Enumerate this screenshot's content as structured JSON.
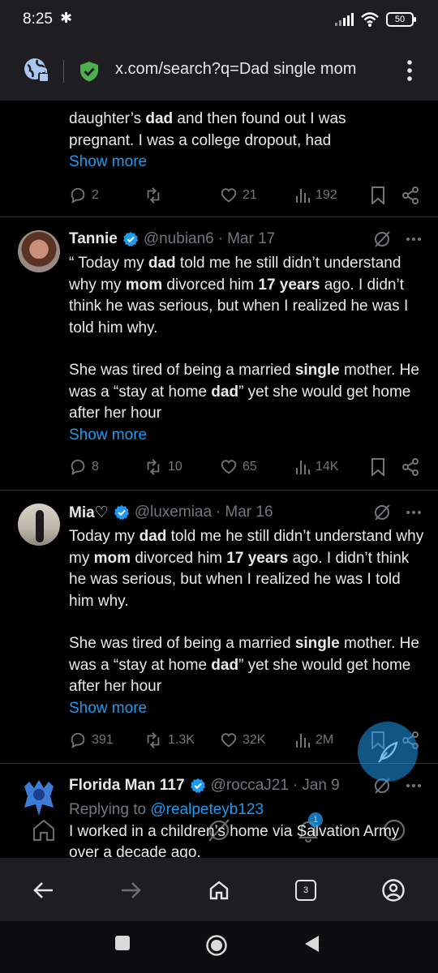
{
  "status_bar": {
    "time": "8:25",
    "battery": "50"
  },
  "browser": {
    "url": "x.com/search?q=Dad single mom",
    "tab_count": "3"
  },
  "tweets": [
    {
      "text_lines": [
        "daughter’s ",
        "dad",
        " and then found out I was",
        "pregnant. I was a college dropout, had"
      ],
      "show_more": "Show more",
      "replies": "2",
      "retweets": "",
      "likes": "21",
      "views": "192"
    },
    {
      "name": "Tannie",
      "handle": "@nubian6",
      "date": "Mar 17",
      "p1": [
        "“ Today my ",
        "dad",
        " told me he still didn’t understand why my ",
        "mom",
        " divorced him ",
        "17 years",
        " ago. I didn’t think he was serious, but when I realized he was I told him why."
      ],
      "p2": [
        "She was tired of being a married ",
        "single",
        " mother. He was a “stay at home ",
        "dad",
        "” yet she would get home after her hour"
      ],
      "show_more": "Show more",
      "replies": "8",
      "retweets": "10",
      "likes": "65",
      "views": "14K"
    },
    {
      "name": "Mia♡",
      "handle": "@luxemiaa",
      "date": "Mar 16",
      "p1": [
        "Today my ",
        "dad",
        " told me he still didn’t understand why my ",
        "mom",
        " divorced him ",
        "17 years",
        " ago. I didn’t think he was serious, but when I realized he was I told him why."
      ],
      "p2": [
        "She was tired of being a married ",
        "single",
        " mother. He was a “stay at home ",
        "dad",
        "” yet she would get home after her hour"
      ],
      "show_more": "Show more",
      "replies": "391",
      "retweets": "1.3K",
      "likes": "32K",
      "views": "2M"
    },
    {
      "name": "Florida Man 117",
      "handle": "@roccaJ21",
      "date": "Jan 9",
      "replying_prefix": "Replying to ",
      "replying_to": "@realpeteyb123",
      "text": "I worked in a children’s home via Salvation Army over a decade ago."
    }
  ],
  "x_nav": {
    "notification_badge": "1"
  },
  "colors": {
    "background": "#000000",
    "accent": "#1d9bf0",
    "muted": "#71767b",
    "text": "#e7e9ea",
    "chrome": "#1e1e22"
  }
}
